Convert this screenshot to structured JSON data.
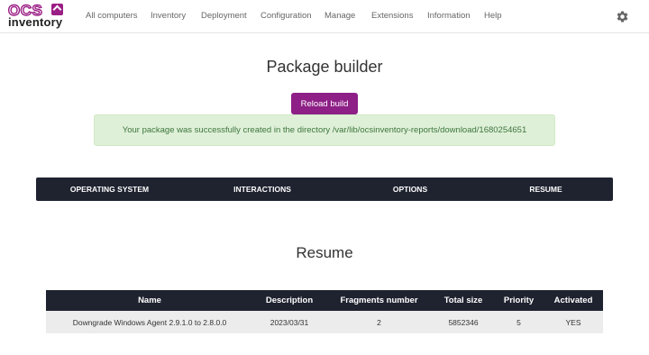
{
  "brand": {
    "logo_top": "OCS",
    "logo_bottom": "inventory",
    "accent_color": "#8d1f86"
  },
  "nav": {
    "items": [
      {
        "label": "All computers"
      },
      {
        "label": "Inventory"
      },
      {
        "label": "Deployment"
      },
      {
        "label": "Configuration"
      },
      {
        "label": "Manage"
      },
      {
        "label": "Extensions"
      },
      {
        "label": "Information"
      },
      {
        "label": "Help"
      }
    ],
    "settings_icon": "gear-icon"
  },
  "page": {
    "title": "Package builder",
    "reload_button": "Reload build",
    "success_message": "Your package was successfully created in the directory /var/lib/ocsinventory-reports/download/1680254651",
    "success_color": "#dff0d8"
  },
  "steps": [
    {
      "label": "OPERATING SYSTEM"
    },
    {
      "label": "INTERACTIONS"
    },
    {
      "label": "OPTIONS"
    },
    {
      "label": "RESUME"
    }
  ],
  "resume": {
    "title": "Resume",
    "columns": [
      "Name",
      "Description",
      "Fragments number",
      "Total size",
      "Priority",
      "Activated"
    ],
    "rows": [
      [
        "Downgrade Windows Agent 2.9.1.0 to 2.8.0.0",
        "2023/03/31",
        "2",
        "5852346",
        "5",
        "YES"
      ]
    ]
  }
}
